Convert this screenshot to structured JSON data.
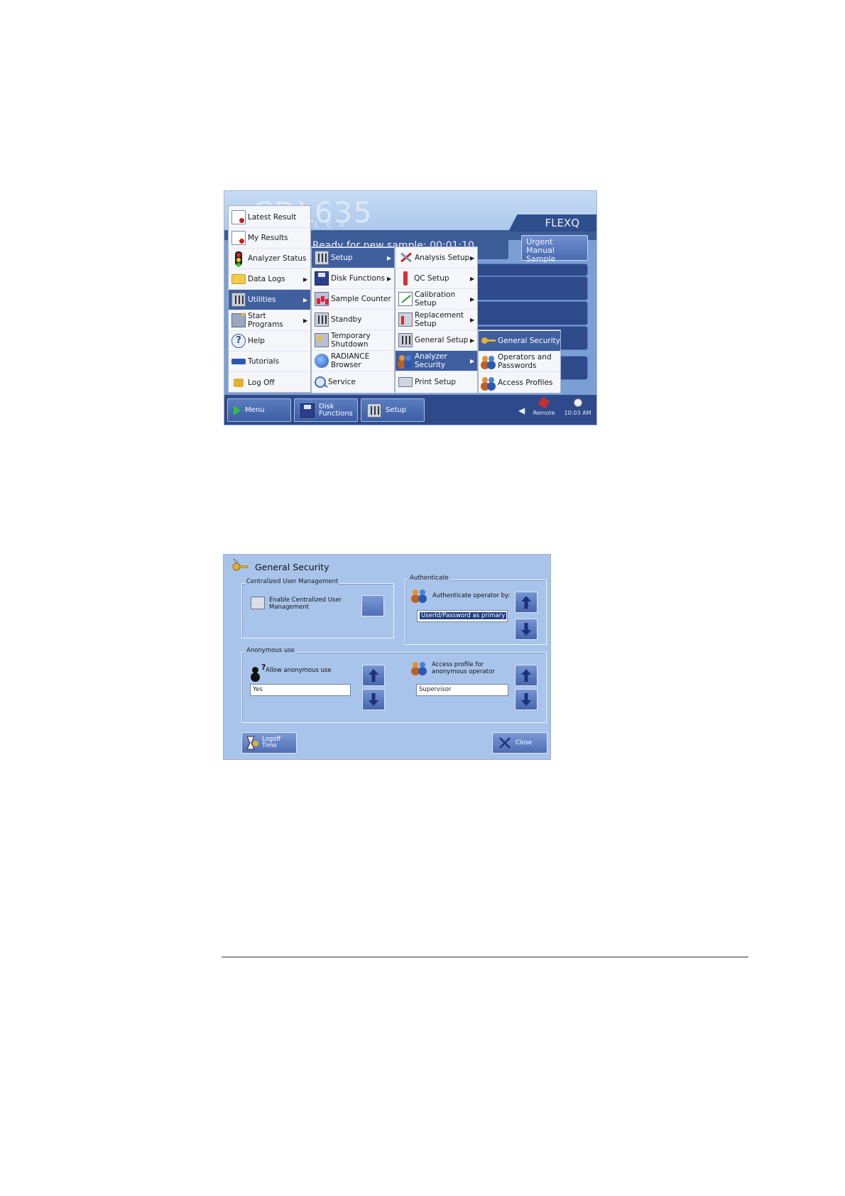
{
  "screen1": {
    "logo": "CDL635",
    "logo_sub": "FLEX",
    "brand": "FLEXQ",
    "status": "Ready for new sample: 00:01:10",
    "urgent_button": "Urgent Manual Sample",
    "main_menu": [
      {
        "label": "Latest Result",
        "icon": "document-icon"
      },
      {
        "label": "My Results",
        "icon": "document-icon"
      },
      {
        "label": "Analyzer Status",
        "icon": "traffic-light-icon"
      },
      {
        "label": "Data Logs",
        "icon": "folder-icon",
        "has_submenu": true
      },
      {
        "label": "Utilities",
        "icon": "sliders-icon",
        "has_submenu": true,
        "selected": true
      },
      {
        "label": "Start Programs",
        "icon": "programs-icon",
        "has_submenu": true
      },
      {
        "label": "Help",
        "icon": "help-icon"
      },
      {
        "label": "Tutorials",
        "icon": "graduation-cap-icon"
      },
      {
        "label": "Log Off",
        "icon": "lock-icon"
      }
    ],
    "utilities_menu": [
      {
        "label": "Setup",
        "icon": "sliders-icon",
        "has_submenu": true,
        "selected": true
      },
      {
        "label": "Disk Functions",
        "icon": "disk-icon",
        "has_submenu": true
      },
      {
        "label": "Sample Counter",
        "icon": "counter-icon"
      },
      {
        "label": "Standby",
        "icon": "standby-icon"
      },
      {
        "label": "Temporary Shutdown",
        "icon": "warning-icon"
      },
      {
        "label": "RADIANCE Browser",
        "icon": "globe-icon"
      },
      {
        "label": "Service",
        "icon": "magnifier-icon"
      }
    ],
    "setup_menu": [
      {
        "label": "Analysis Setup",
        "icon": "tools-icon",
        "has_submenu": true
      },
      {
        "label": "QC Setup",
        "icon": "vial-icon",
        "has_submenu": true
      },
      {
        "label": "Calibration Setup",
        "icon": "calibration-icon",
        "has_submenu": true
      },
      {
        "label": "Replacement Setup",
        "icon": "replacement-icon",
        "has_submenu": true
      },
      {
        "label": "General Setup",
        "icon": "sliders-icon",
        "has_submenu": true
      },
      {
        "label": "Analyzer Security",
        "icon": "people-icon",
        "has_submenu": true,
        "selected": true
      },
      {
        "label": "Print Setup",
        "icon": "printer-icon"
      }
    ],
    "security_menu": [
      {
        "label": "General Security",
        "icon": "key-icon",
        "selected": true
      },
      {
        "label": "Operators and Passwords",
        "icon": "people-icon"
      },
      {
        "label": "Access Profiles",
        "icon": "people-icon"
      }
    ],
    "taskbar": [
      {
        "label": "Menu",
        "icon": "play-icon"
      },
      {
        "label": "Disk Functions",
        "icon": "disk-icon"
      },
      {
        "label": "Setup",
        "icon": "sliders-icon"
      }
    ],
    "remote_label": "Remote",
    "time": "10:03 AM"
  },
  "screen2": {
    "title": "General Security",
    "centralized": {
      "group_label": "Centralized User Management",
      "label": "Enable Centralized User Management"
    },
    "authenticate": {
      "group_label": "Authenticate",
      "label": "Authenticate operator by:",
      "value": "UserId/Password as primary"
    },
    "anonymous": {
      "group_label": "Anonymous use",
      "allow_label": "Allow anonymous use",
      "allow_value": "Yes",
      "profile_label": "Access profile for anonymous operator",
      "profile_value": "Supervisor"
    },
    "logoff_button": "Logoff Time",
    "close_button": "Close"
  }
}
